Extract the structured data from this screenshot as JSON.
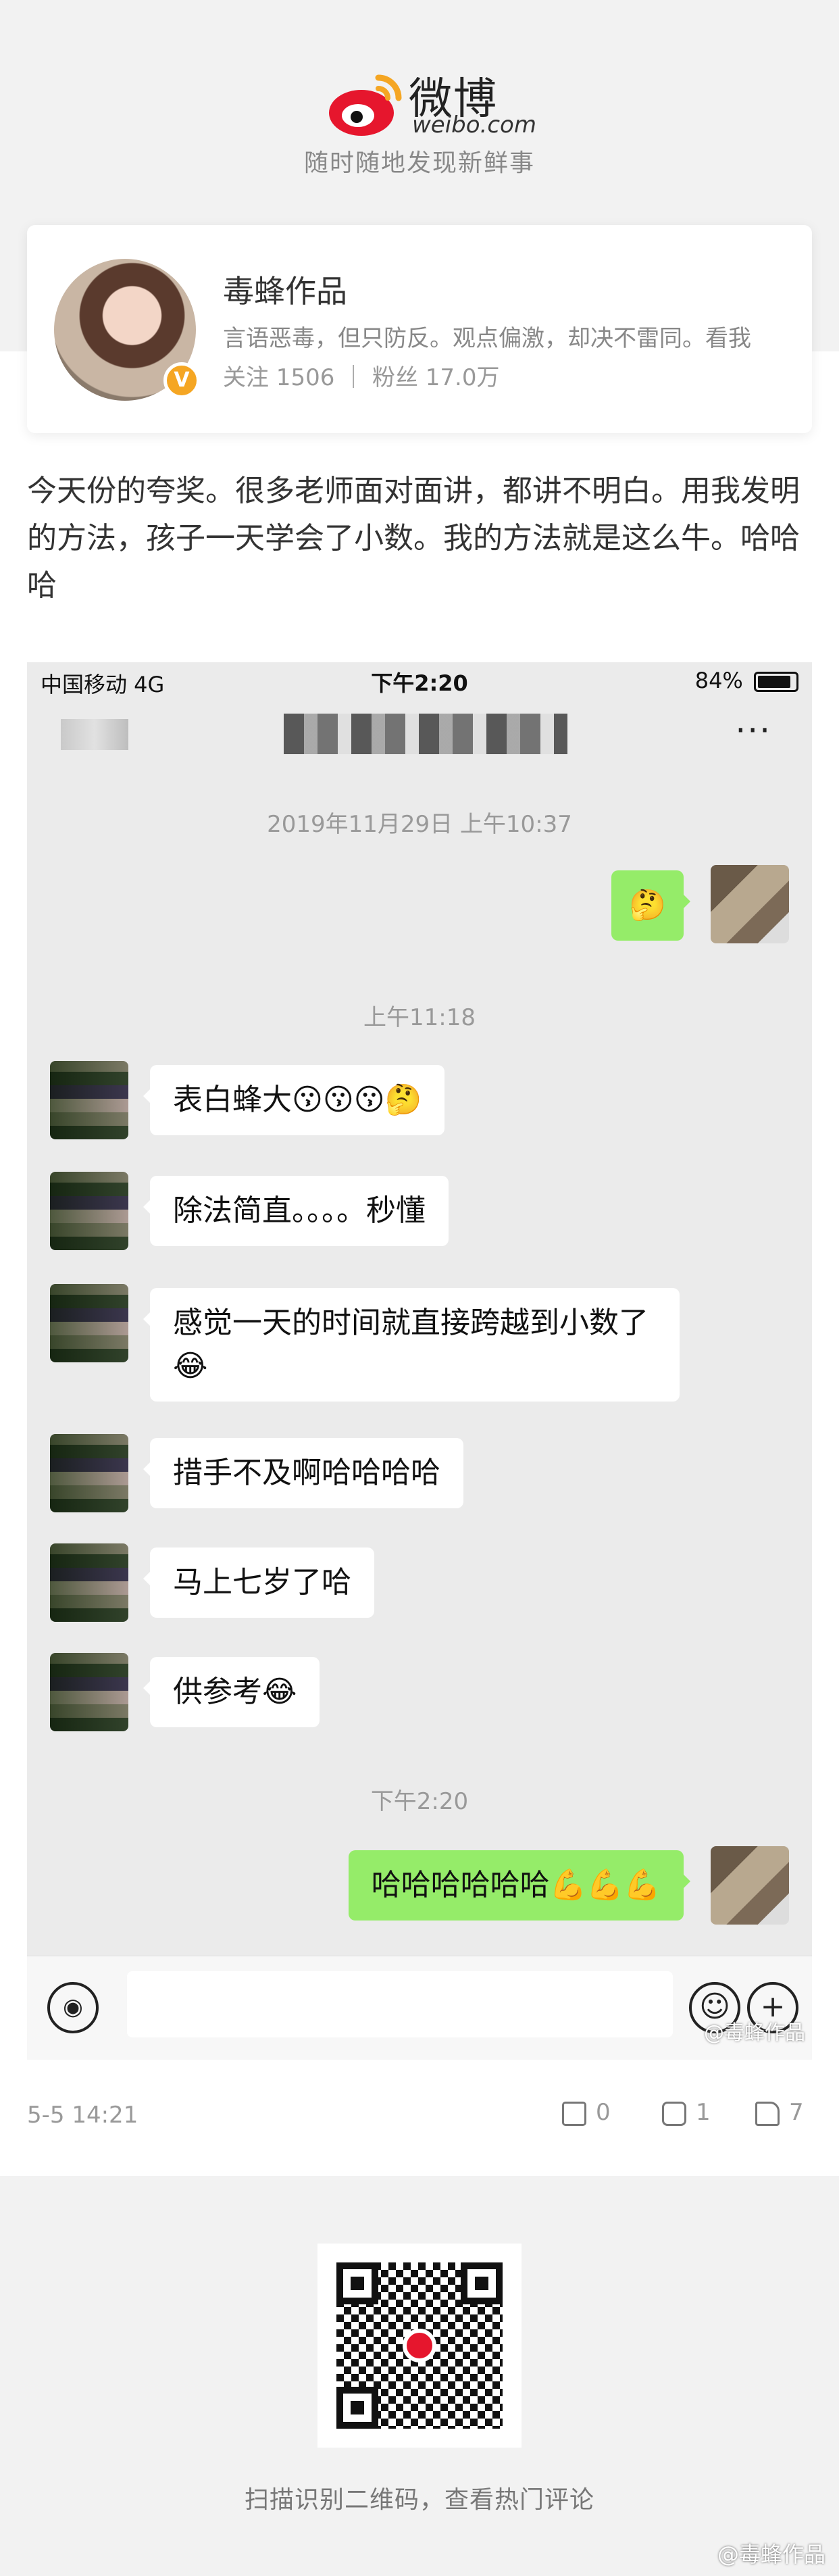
{
  "brand": {
    "name": "微博",
    "domain": "weibo.com",
    "slogan": "随时随地发现新鲜事",
    "accent": "#e6162d"
  },
  "profile": {
    "name": "毒蜂作品",
    "bio": "言语恶毒，但只防反。观点偏激，却决不雷同。看我",
    "stats": "关注 1506 ｜ 粉丝 17.0万",
    "verified_badge": "V"
  },
  "post": {
    "text": "今天份的夸奖。很多老师面对面讲，都讲不明白。用我发明的方法，孩子一天学会了小数。我的方法就是这么牛。哈哈哈",
    "time": "5-5 14:21",
    "repost_count": "0",
    "comment_count": "1",
    "like_count": "7"
  },
  "screenshot": {
    "status_left": "中国移动  4G",
    "status_time": "下午2:20",
    "status_right": "84%",
    "more_icon": "···",
    "times": [
      "2019年11月29日 上午10:37",
      "上午11:18",
      "下午2:20"
    ],
    "messages": [
      {
        "from": "me",
        "text": "🤔"
      },
      {
        "from": "them",
        "text": "表白蜂大😗😗😗🤔"
      },
      {
        "from": "them",
        "text": "除法简直。。。。秒懂"
      },
      {
        "from": "them",
        "text": "感觉一天的时间就直接跨越到小数了😂"
      },
      {
        "from": "them",
        "text": "措手不及啊哈哈哈哈"
      },
      {
        "from": "them",
        "text": "马上七岁了哈"
      },
      {
        "from": "them",
        "text": "供参考😂"
      },
      {
        "from": "me",
        "text": "哈哈哈哈哈哈💪💪💪"
      }
    ],
    "watermark": "@毒蜂作品"
  },
  "footer": {
    "qr_caption": "扫描识别二维码，查看热门评论",
    "corner_watermark": "@毒蜂作品"
  }
}
